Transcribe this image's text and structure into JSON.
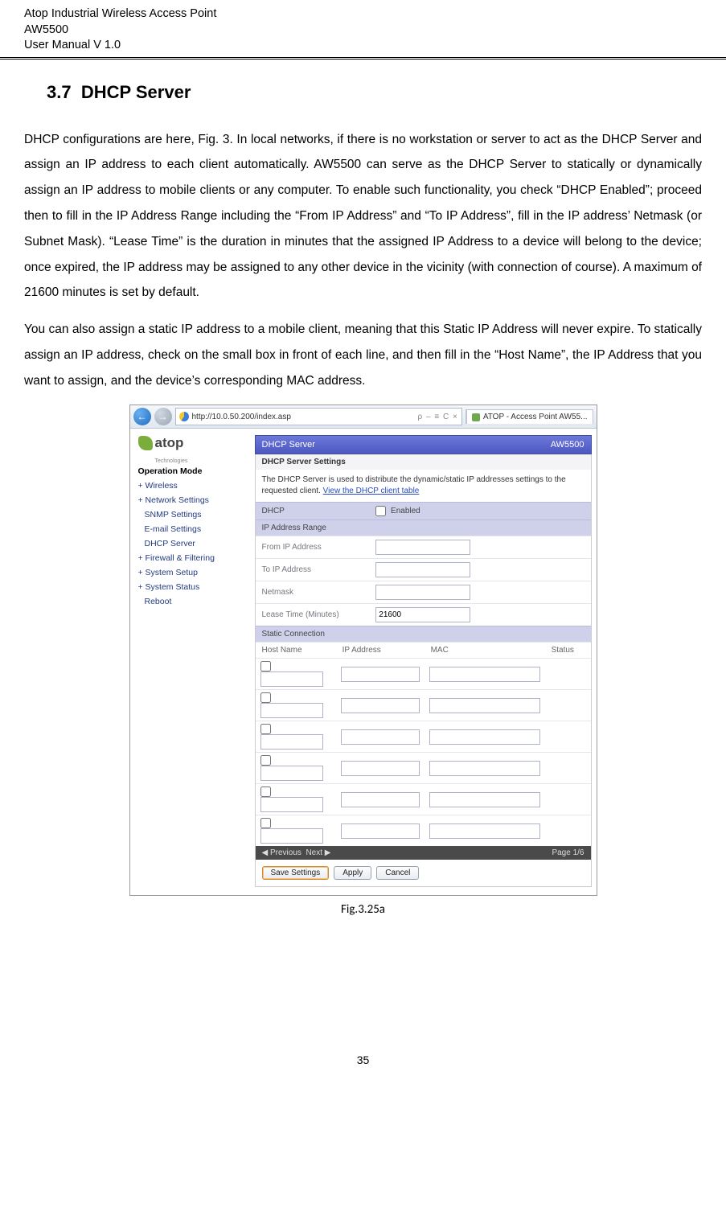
{
  "header": {
    "line1": "Atop Industrial Wireless Access Point",
    "line2": "AW5500",
    "line3": "User Manual V 1.0"
  },
  "section": {
    "num": "3.7",
    "title": "DHCP Server"
  },
  "para1": "DHCP configurations are here, Fig. 3. In local networks, if there is no workstation or server to act as the DHCP Server and assign an IP address to each client automatically. AW5500 can serve as the DHCP Server to statically or dynamically assign an IP address to mobile clients or any computer. To enable such functionality, you check “DHCP Enabled”; proceed then to fill in the IP Address Range including the “From IP Address” and “To IP Address”, fill in the IP address’ Netmask (or Subnet Mask). “Lease Time” is the duration in minutes that the assigned IP Address to a device will belong to the device; once expired, the IP address may be assigned to any other device in the vicinity (with connection of course). A maximum of 21600 minutes is set by default.",
  "para2": "You can also assign a static IP address to a mobile client, meaning that this Static IP Address will never expire. To statically assign an IP address, check on the small box in front of each line, and then fill in the “Host Name”, the IP Address that you want to assign, and the device’s corresponding MAC address.",
  "browser": {
    "url": "http://10.0.50.200/index.asp",
    "search_icons": "⍴ ▼",
    "addr_suffix": "ρ – ≡ C ×",
    "tab_label": "ATOP - Access Point AW55..."
  },
  "logo": {
    "brand": "atop",
    "sub": "Technologies"
  },
  "sidebar": [
    {
      "label": "Operation Mode",
      "bold": true
    },
    {
      "label": "+ Wireless",
      "bold": false
    },
    {
      "label": "+ Network Settings",
      "bold": false
    },
    {
      "label": "SNMP Settings",
      "bold": false
    },
    {
      "label": "E-mail Settings",
      "bold": false
    },
    {
      "label": "DHCP Server",
      "bold": false
    },
    {
      "label": "+ Firewall & Filtering",
      "bold": false
    },
    {
      "label": "+ System Setup",
      "bold": false
    },
    {
      "label": "+ System Status",
      "bold": false
    },
    {
      "label": "Reboot",
      "bold": false
    }
  ],
  "panel": {
    "bar_left": "DHCP Server",
    "bar_right": "AW5500",
    "box_title": "DHCP Server Settings",
    "desc_pre": "The DHCP Server is used to distribute the dynamic/static IP addresses settings to the requested client. ",
    "desc_link": "View the DHCP client table"
  },
  "fields": {
    "dhcp_label": "DHCP",
    "dhcp_check_label": "Enabled",
    "range_hdr": "IP Address Range",
    "from_label": "From IP Address",
    "to_label": "To IP Address",
    "netmask_label": "Netmask",
    "lease_label": "Lease Time (Minutes)",
    "lease_value": "21600",
    "static_hdr": "Static Connection",
    "col_host": "Host Name",
    "col_ip": "IP Address",
    "col_mac": "MAC",
    "col_status": "Status"
  },
  "pager": {
    "prev": "◀ Previous",
    "next": "Next ▶",
    "page": "Page 1/6"
  },
  "buttons": {
    "save": "Save Settings",
    "apply": "Apply",
    "cancel": "Cancel"
  },
  "caption": "Fig.3.25a",
  "pagenum": "35"
}
